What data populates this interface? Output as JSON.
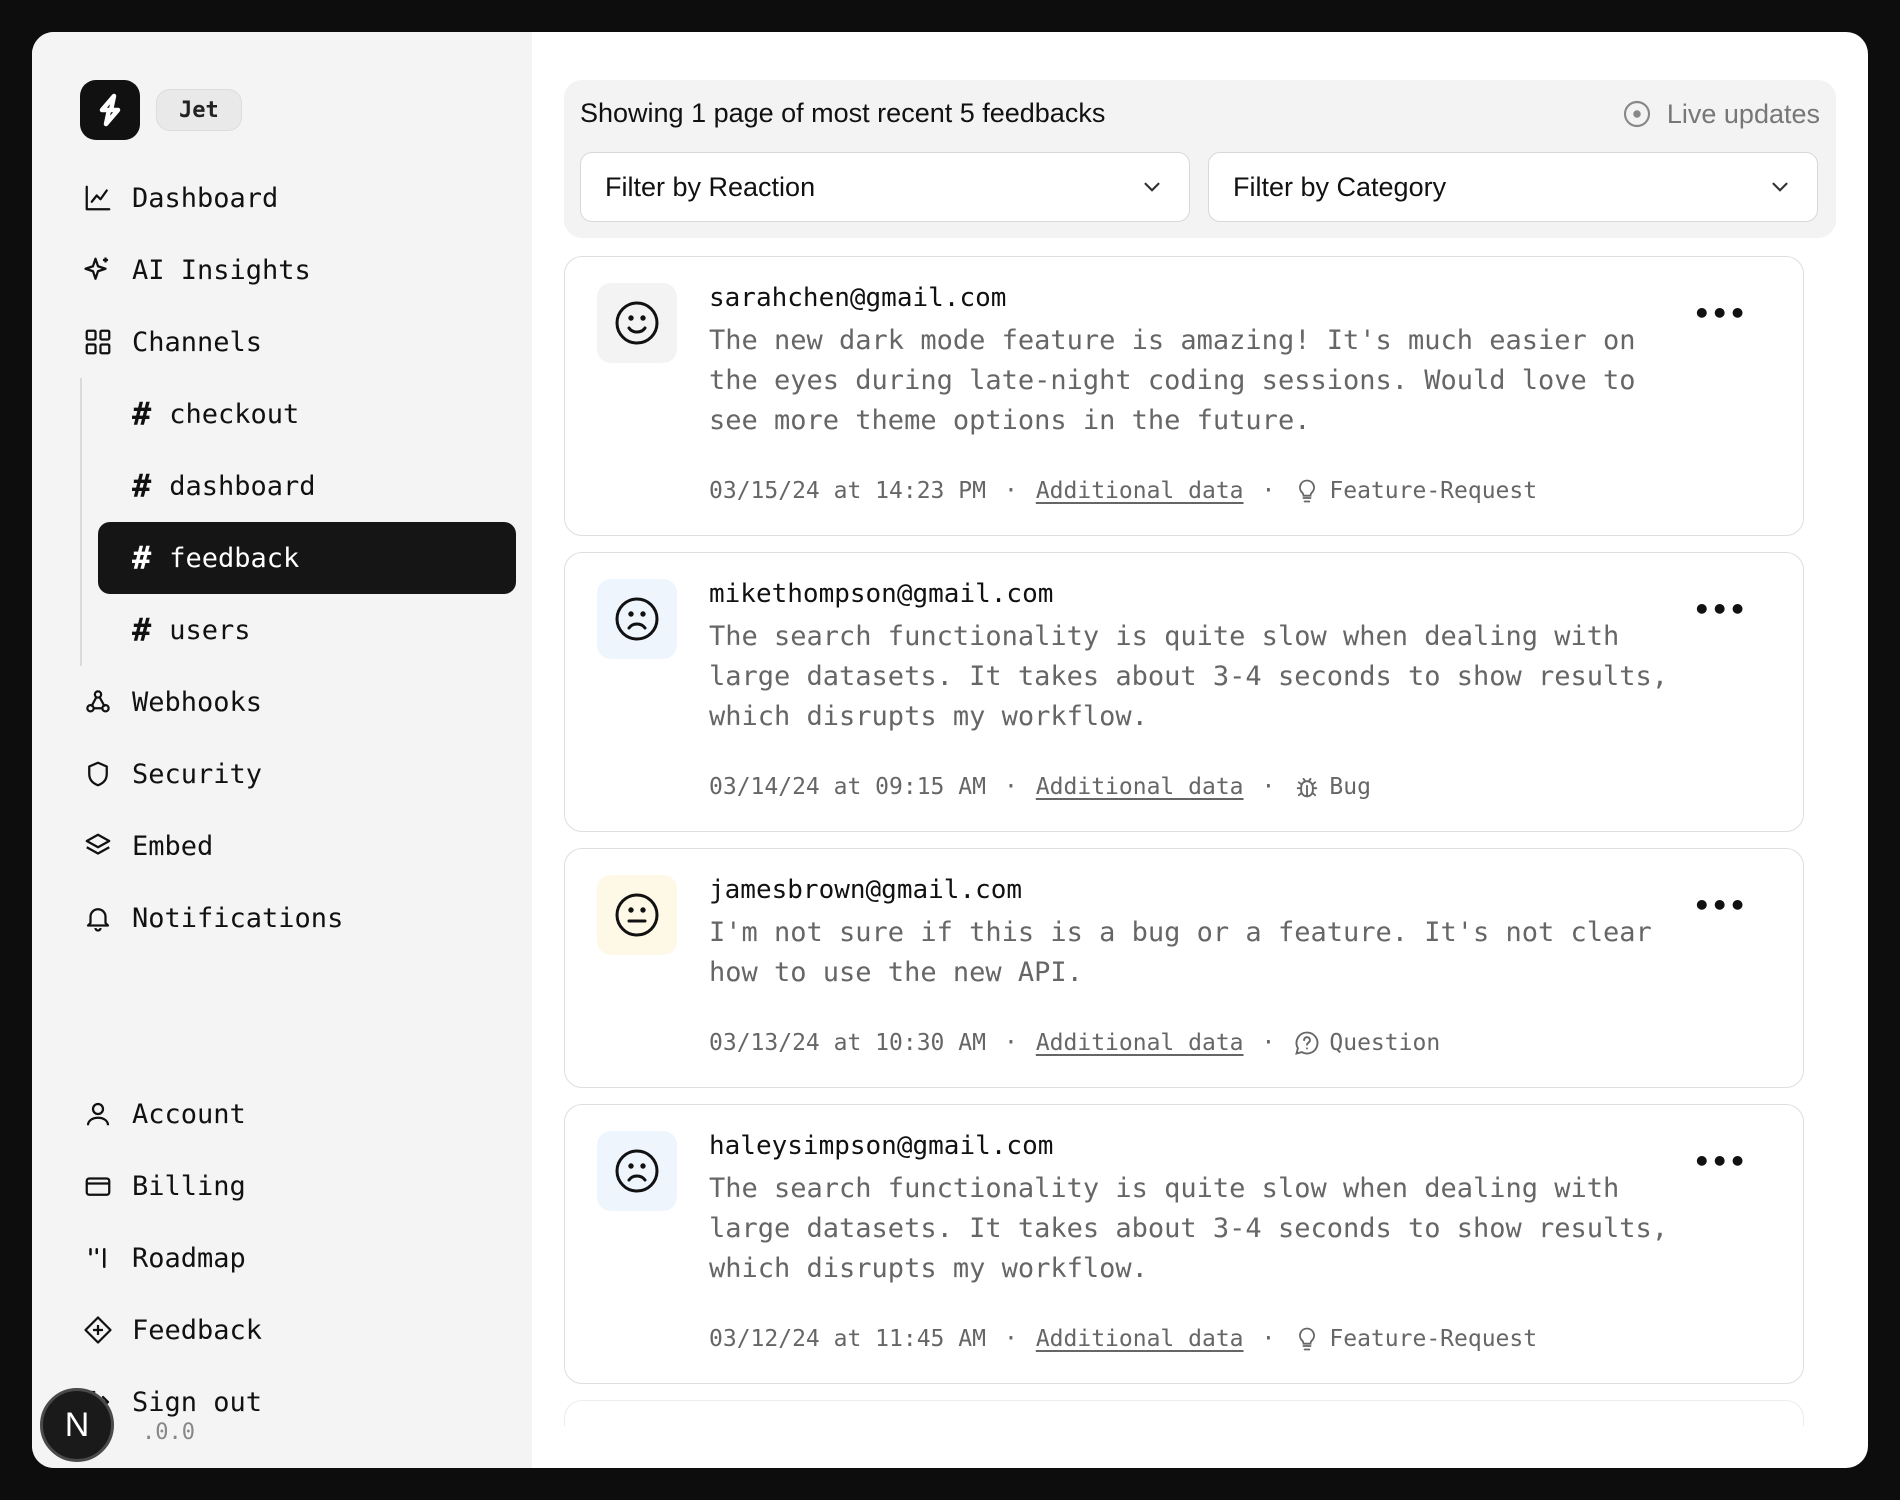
{
  "brand": {
    "workspace": "Jet"
  },
  "sidebar": {
    "nav": [
      {
        "label": "Dashboard",
        "icon": "chart-line-icon"
      },
      {
        "label": "AI Insights",
        "icon": "sparkles-icon"
      },
      {
        "label": "Channels",
        "icon": "grid-icon"
      }
    ],
    "channels": [
      {
        "label": "checkout",
        "active": false
      },
      {
        "label": "dashboard",
        "active": false
      },
      {
        "label": "feedback",
        "active": true
      },
      {
        "label": "users",
        "active": false
      }
    ],
    "nav2": [
      {
        "label": "Webhooks",
        "icon": "webhook-icon"
      },
      {
        "label": "Security",
        "icon": "shield-icon"
      },
      {
        "label": "Embed",
        "icon": "layers-icon"
      },
      {
        "label": "Notifications",
        "icon": "bell-icon"
      }
    ],
    "bottom": [
      {
        "label": "Account",
        "icon": "user-icon"
      },
      {
        "label": "Billing",
        "icon": "credit-card-icon"
      },
      {
        "label": "Roadmap",
        "icon": "roadmap-icon"
      },
      {
        "label": "Feedback",
        "icon": "diamond-plus-icon"
      },
      {
        "label": "Sign out",
        "icon": "sign-out-icon"
      }
    ],
    "version": ".0.0",
    "n_badge": "N"
  },
  "toolbar": {
    "showing": "Showing 1 page of most recent 5 feedbacks",
    "live_updates": "Live updates",
    "filter_reaction": "Filter by Reaction",
    "filter_category": "Filter by Category"
  },
  "feedback": [
    {
      "email": "sarahchen@gmail.com",
      "reaction": "happy",
      "message": "The new dark mode feature is amazing! It's much easier on the eyes during late-night coding sessions. Would love to see more theme options in the future.",
      "timestamp": "03/15/24 at 14:23 PM",
      "link": "Additional data",
      "category": "Feature-Request",
      "category_icon": "lightbulb-icon"
    },
    {
      "email": "mikethompson@gmail.com",
      "reaction": "sad",
      "message": "The search functionality is quite slow when dealing with large datasets. It takes about 3-4 seconds to show results, which disrupts my workflow.",
      "timestamp": "03/14/24 at 09:15 AM",
      "link": "Additional data",
      "category": "Bug",
      "category_icon": "bug-icon"
    },
    {
      "email": "jamesbrown@gmail.com",
      "reaction": "neutral",
      "message": "I'm not sure if this is a bug or a feature. It's not clear how to use the new API.",
      "timestamp": "03/13/24 at 10:30 AM",
      "link": "Additional data",
      "category": "Question",
      "category_icon": "question-bubble-icon"
    },
    {
      "email": "haleysimpson@gmail.com",
      "reaction": "sad",
      "message": "The search functionality is quite slow when dealing with large datasets. It takes about 3-4 seconds to show results, which disrupts my workflow.",
      "timestamp": "03/12/24 at 11:45 AM",
      "link": "Additional data",
      "category": "Feature-Request",
      "category_icon": "lightbulb-icon"
    }
  ],
  "colors": {
    "happy_bg": "#f3f3f3",
    "sad_bg": "#eef5fd",
    "neutral_bg": "#fdf9e6",
    "active_channel": "#151515"
  }
}
